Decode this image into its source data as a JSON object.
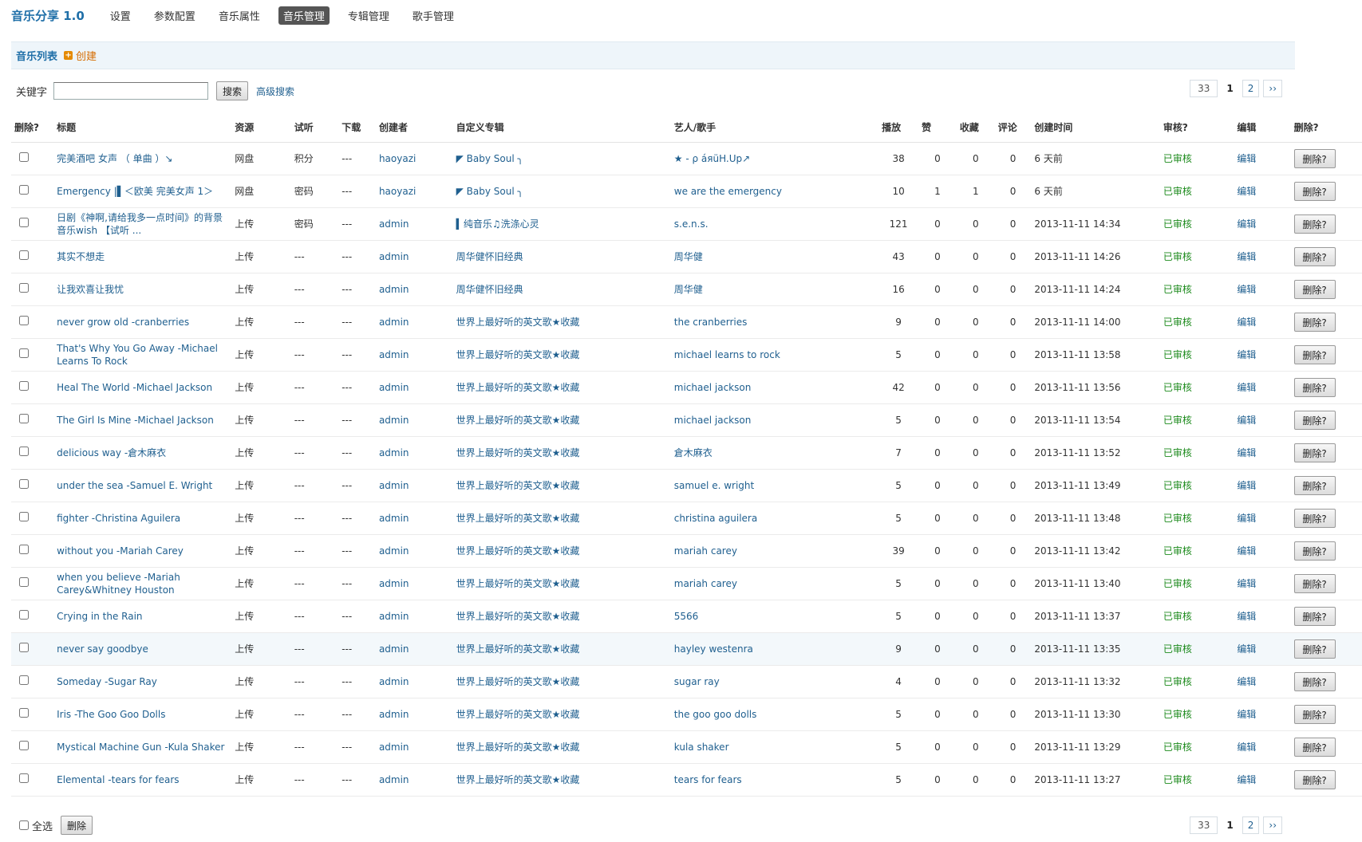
{
  "nav": {
    "brand": "音乐分享 1.0",
    "items": [
      {
        "label": "设置",
        "active": false
      },
      {
        "label": "参数配置",
        "active": false
      },
      {
        "label": "音乐属性",
        "active": false
      },
      {
        "label": "音乐管理",
        "active": true
      },
      {
        "label": "专辑管理",
        "active": false
      },
      {
        "label": "歌手管理",
        "active": false
      }
    ]
  },
  "section": {
    "title": "音乐列表",
    "create_label": "创建"
  },
  "search": {
    "label": "关键字",
    "value": "",
    "button": "搜索",
    "advanced": "高级搜索"
  },
  "pager": {
    "total": "33",
    "current": "1",
    "next_page": "2",
    "next": "››"
  },
  "columns": [
    "删除?",
    "标题",
    "资源",
    "试听",
    "下载",
    "创建者",
    "自定义专辑",
    "艺人/歌手",
    "播放",
    "赞",
    "收藏",
    "评论",
    "创建时间",
    "审核?",
    "编辑",
    "删除?"
  ],
  "rows": [
    {
      "title": "完美酒吧 女声 （ 单曲 ）↘",
      "source": "网盘",
      "preview": "积分",
      "download": "---",
      "creator": "haoyazi",
      "album": "◤ Baby Soul ╮",
      "artist": "★ - ρ áяüH.Up↗",
      "plays": "38",
      "likes": "0",
      "favs": "0",
      "comments": "0",
      "created": "6 天前",
      "status": "已审核",
      "edit": "编辑",
      "delete": "删除?"
    },
    {
      "title": "Emergency |▌＜欧美 完美女声 1＞",
      "source": "网盘",
      "preview": "密码",
      "download": "---",
      "creator": "haoyazi",
      "album": "◤ Baby Soul ╮",
      "artist": "we are the emergency",
      "plays": "10",
      "likes": "1",
      "favs": "1",
      "comments": "0",
      "created": "6 天前",
      "status": "已审核",
      "edit": "编辑",
      "delete": "删除?"
    },
    {
      "title": "日剧《神啊,请给我多一点时间》的背景音乐wish 【试听 ...",
      "source": "上传",
      "preview": "密码",
      "download": "---",
      "creator": "admin",
      "album": "▍纯音乐♫洗涤心灵",
      "artist": "s.e.n.s.",
      "plays": "121",
      "likes": "0",
      "favs": "0",
      "comments": "0",
      "created": "2013-11-11 14:34",
      "status": "已审核",
      "edit": "编辑",
      "delete": "删除?"
    },
    {
      "title": "其实不想走",
      "source": "上传",
      "preview": "---",
      "download": "---",
      "creator": "admin",
      "album": "周华健怀旧经典",
      "artist": "周华健",
      "plays": "43",
      "likes": "0",
      "favs": "0",
      "comments": "0",
      "created": "2013-11-11 14:26",
      "status": "已审核",
      "edit": "编辑",
      "delete": "删除?"
    },
    {
      "title": "让我欢喜让我忧",
      "source": "上传",
      "preview": "---",
      "download": "---",
      "creator": "admin",
      "album": "周华健怀旧经典",
      "artist": "周华健",
      "plays": "16",
      "likes": "0",
      "favs": "0",
      "comments": "0",
      "created": "2013-11-11 14:24",
      "status": "已审核",
      "edit": "编辑",
      "delete": "删除?"
    },
    {
      "title": "never grow old -cranberries",
      "source": "上传",
      "preview": "---",
      "download": "---",
      "creator": "admin",
      "album": "世界上最好听的英文歌★收藏",
      "artist": "the cranberries",
      "plays": "9",
      "likes": "0",
      "favs": "0",
      "comments": "0",
      "created": "2013-11-11 14:00",
      "status": "已审核",
      "edit": "编辑",
      "delete": "删除?"
    },
    {
      "title": "That's Why You Go Away -Michael Learns To Rock",
      "source": "上传",
      "preview": "---",
      "download": "---",
      "creator": "admin",
      "album": "世界上最好听的英文歌★收藏",
      "artist": "michael learns to rock",
      "plays": "5",
      "likes": "0",
      "favs": "0",
      "comments": "0",
      "created": "2013-11-11 13:58",
      "status": "已审核",
      "edit": "编辑",
      "delete": "删除?"
    },
    {
      "title": "Heal The World -Michael Jackson",
      "source": "上传",
      "preview": "---",
      "download": "---",
      "creator": "admin",
      "album": "世界上最好听的英文歌★收藏",
      "artist": "michael jackson",
      "plays": "42",
      "likes": "0",
      "favs": "0",
      "comments": "0",
      "created": "2013-11-11 13:56",
      "status": "已审核",
      "edit": "编辑",
      "delete": "删除?"
    },
    {
      "title": "The Girl Is Mine -Michael Jackson",
      "source": "上传",
      "preview": "---",
      "download": "---",
      "creator": "admin",
      "album": "世界上最好听的英文歌★收藏",
      "artist": "michael jackson",
      "plays": "5",
      "likes": "0",
      "favs": "0",
      "comments": "0",
      "created": "2013-11-11 13:54",
      "status": "已审核",
      "edit": "编辑",
      "delete": "删除?"
    },
    {
      "title": "delicious way -倉木麻衣",
      "source": "上传",
      "preview": "---",
      "download": "---",
      "creator": "admin",
      "album": "世界上最好听的英文歌★收藏",
      "artist": "倉木麻衣",
      "plays": "7",
      "likes": "0",
      "favs": "0",
      "comments": "0",
      "created": "2013-11-11 13:52",
      "status": "已审核",
      "edit": "编辑",
      "delete": "删除?"
    },
    {
      "title": "under the sea -Samuel E. Wright",
      "source": "上传",
      "preview": "---",
      "download": "---",
      "creator": "admin",
      "album": "世界上最好听的英文歌★收藏",
      "artist": "samuel e. wright",
      "plays": "5",
      "likes": "0",
      "favs": "0",
      "comments": "0",
      "created": "2013-11-11 13:49",
      "status": "已审核",
      "edit": "编辑",
      "delete": "删除?"
    },
    {
      "title": "fighter -Christina Aguilera",
      "source": "上传",
      "preview": "---",
      "download": "---",
      "creator": "admin",
      "album": "世界上最好听的英文歌★收藏",
      "artist": "christina aguilera",
      "plays": "5",
      "likes": "0",
      "favs": "0",
      "comments": "0",
      "created": "2013-11-11 13:48",
      "status": "已审核",
      "edit": "编辑",
      "delete": "删除?"
    },
    {
      "title": "without you -Mariah Carey",
      "source": "上传",
      "preview": "---",
      "download": "---",
      "creator": "admin",
      "album": "世界上最好听的英文歌★收藏",
      "artist": "mariah carey",
      "plays": "39",
      "likes": "0",
      "favs": "0",
      "comments": "0",
      "created": "2013-11-11 13:42",
      "status": "已审核",
      "edit": "编辑",
      "delete": "删除?"
    },
    {
      "title": "when you believe -Mariah Carey&Whitney Houston",
      "source": "上传",
      "preview": "---",
      "download": "---",
      "creator": "admin",
      "album": "世界上最好听的英文歌★收藏",
      "artist": "mariah carey",
      "plays": "5",
      "likes": "0",
      "favs": "0",
      "comments": "0",
      "created": "2013-11-11 13:40",
      "status": "已审核",
      "edit": "编辑",
      "delete": "删除?"
    },
    {
      "title": "Crying in the Rain",
      "source": "上传",
      "preview": "---",
      "download": "---",
      "creator": "admin",
      "album": "世界上最好听的英文歌★收藏",
      "artist": "5566",
      "plays": "5",
      "likes": "0",
      "favs": "0",
      "comments": "0",
      "created": "2013-11-11 13:37",
      "status": "已审核",
      "edit": "编辑",
      "delete": "删除?"
    },
    {
      "title": "never say goodbye",
      "source": "上传",
      "preview": "---",
      "download": "---",
      "creator": "admin",
      "album": "世界上最好听的英文歌★收藏",
      "artist": "hayley westenra",
      "plays": "9",
      "likes": "0",
      "favs": "0",
      "comments": "0",
      "created": "2013-11-11 13:35",
      "status": "已审核",
      "edit": "编辑",
      "delete": "删除?",
      "highlight": true
    },
    {
      "title": "Someday -Sugar Ray",
      "source": "上传",
      "preview": "---",
      "download": "---",
      "creator": "admin",
      "album": "世界上最好听的英文歌★收藏",
      "artist": "sugar ray",
      "plays": "4",
      "likes": "0",
      "favs": "0",
      "comments": "0",
      "created": "2013-11-11 13:32",
      "status": "已审核",
      "edit": "编辑",
      "delete": "删除?"
    },
    {
      "title": "Iris -The Goo Goo Dolls",
      "source": "上传",
      "preview": "---",
      "download": "---",
      "creator": "admin",
      "album": "世界上最好听的英文歌★收藏",
      "artist": "the goo goo dolls",
      "plays": "5",
      "likes": "0",
      "favs": "0",
      "comments": "0",
      "created": "2013-11-11 13:30",
      "status": "已审核",
      "edit": "编辑",
      "delete": "删除?"
    },
    {
      "title": "Mystical Machine Gun -Kula Shaker",
      "source": "上传",
      "preview": "---",
      "download": "---",
      "creator": "admin",
      "album": "世界上最好听的英文歌★收藏",
      "artist": "kula shaker",
      "plays": "5",
      "likes": "0",
      "favs": "0",
      "comments": "0",
      "created": "2013-11-11 13:29",
      "status": "已审核",
      "edit": "编辑",
      "delete": "删除?"
    },
    {
      "title": "Elemental -tears for fears",
      "source": "上传",
      "preview": "---",
      "download": "---",
      "creator": "admin",
      "album": "世界上最好听的英文歌★收藏",
      "artist": "tears for fears",
      "plays": "5",
      "likes": "0",
      "favs": "0",
      "comments": "0",
      "created": "2013-11-11 13:27",
      "status": "已审核",
      "edit": "编辑",
      "delete": "删除?"
    }
  ],
  "footer": {
    "select_all": "全选",
    "delete_button": "删除"
  },
  "colors": {
    "accent": "#1f6fa8",
    "link": "#1f5f8f",
    "status": "#1c8a1c",
    "create": "#d66c00",
    "section_bg": "#eef5fa"
  }
}
